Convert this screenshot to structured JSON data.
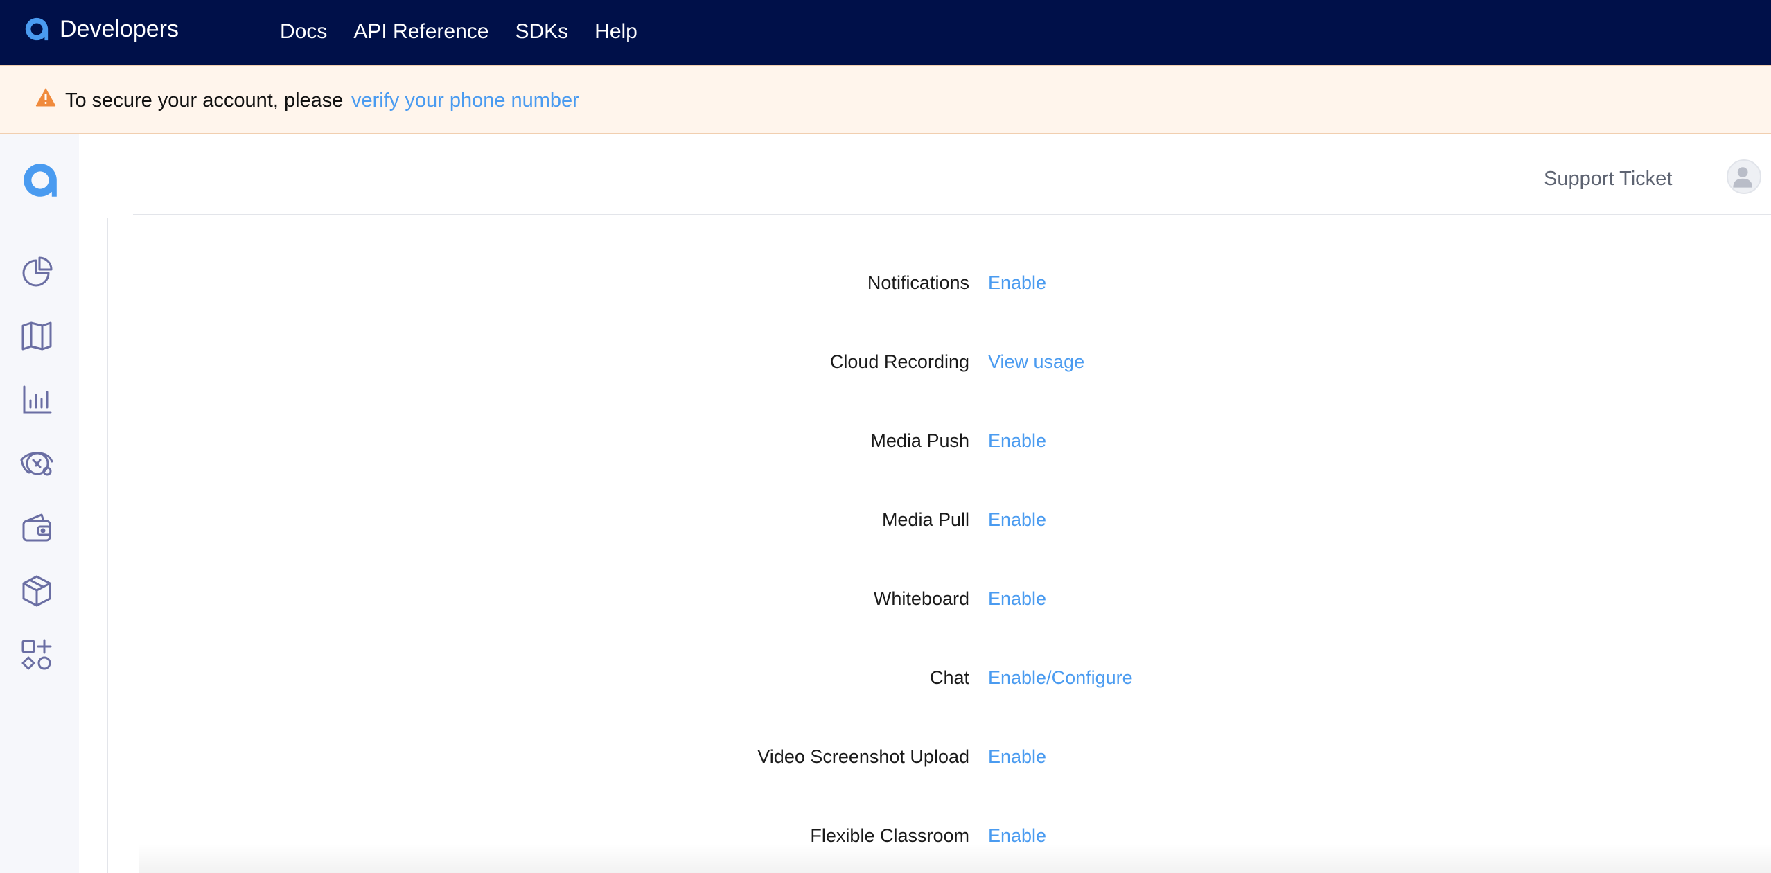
{
  "brand": {
    "name": "Developers",
    "icon": "agora-logo-icon"
  },
  "nav": {
    "items": [
      "Docs",
      "API Reference",
      "SDKs",
      "Help"
    ]
  },
  "banner": {
    "icon": "warning-icon",
    "text": "To secure your account, please",
    "link": "verify your phone number"
  },
  "sidebar": {
    "logo": "agora-logo-icon",
    "items": [
      {
        "icon": "pie-chart-icon"
      },
      {
        "icon": "map-icon"
      },
      {
        "icon": "bar-chart-icon"
      },
      {
        "icon": "support-globe-icon"
      },
      {
        "icon": "wallet-icon"
      },
      {
        "icon": "cube-icon"
      },
      {
        "icon": "apps-icon"
      }
    ]
  },
  "header": {
    "support": "Support Ticket",
    "avatar_icon": "user-avatar-icon"
  },
  "features": [
    {
      "label": "Notifications",
      "action": "Enable"
    },
    {
      "label": "Cloud Recording",
      "action": "View usage"
    },
    {
      "label": "Media Push",
      "action": "Enable"
    },
    {
      "label": "Media Pull",
      "action": "Enable"
    },
    {
      "label": "Whiteboard",
      "action": "Enable"
    },
    {
      "label": "Chat",
      "action": "Enable/Configure"
    },
    {
      "label": "Video Screenshot Upload",
      "action": "Enable"
    },
    {
      "label": "Flexible Classroom",
      "action": "Enable"
    }
  ],
  "colors": {
    "topbar": "#001049",
    "accent": "#4a9bf0",
    "banner_bg": "#fff5ec",
    "sidebar_bg": "#f6f7fb",
    "icon_stroke": "#6a6ea3"
  }
}
